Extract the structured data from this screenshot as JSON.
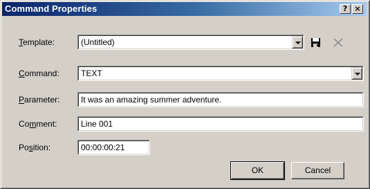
{
  "window": {
    "title": "Command Properties",
    "help_button": "?",
    "close_button": "×"
  },
  "form": {
    "template": {
      "label_prefix": "",
      "label_accel": "T",
      "label_rest": "emplate:",
      "value": "(Untitled)"
    },
    "command": {
      "label_prefix": "",
      "label_accel": "C",
      "label_rest": "ommand:",
      "value": "TEXT"
    },
    "parameter": {
      "label_prefix": "",
      "label_accel": "P",
      "label_rest": "arameter:",
      "value": "It was an amazing summer adventure."
    },
    "comment": {
      "label_prefix": "Co",
      "label_accel": "m",
      "label_rest": "ment:",
      "value": "Line 001"
    },
    "position": {
      "label_prefix": "Po",
      "label_accel": "s",
      "label_rest": "ition:",
      "value": "00:00:00:21"
    }
  },
  "icons": {
    "save": "floppy-disk-icon",
    "delete": "delete-x-icon"
  },
  "buttons": {
    "ok": "OK",
    "cancel": "Cancel"
  }
}
